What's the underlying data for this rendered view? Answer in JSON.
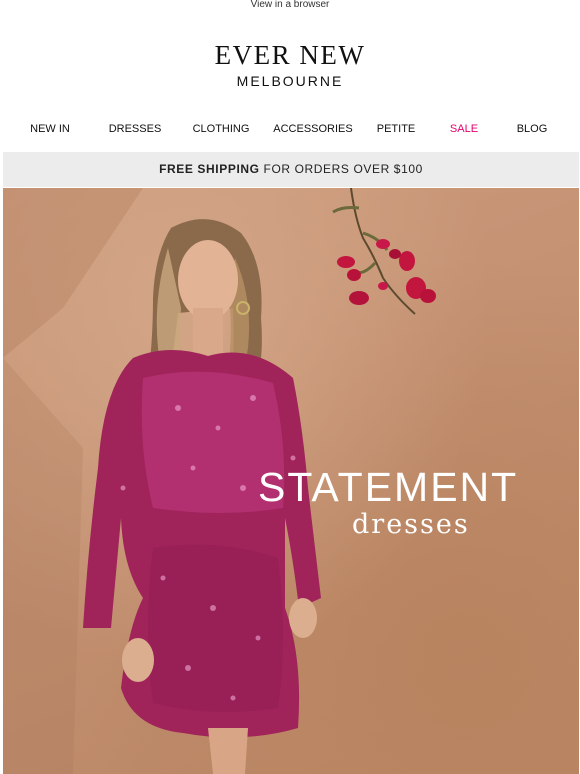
{
  "header": {
    "view_in_browser": "View in a browser"
  },
  "logo": {
    "brand": "EVER NEW",
    "city": "MELBOURNE"
  },
  "nav": {
    "items": [
      {
        "label": "NEW IN"
      },
      {
        "label": "DRESSES"
      },
      {
        "label": "CLOTHING"
      },
      {
        "label": "ACCESSORIES"
      },
      {
        "label": "PETITE"
      },
      {
        "label": "SALE"
      },
      {
        "label": "BLOG"
      }
    ],
    "sale_color": "#e6006e"
  },
  "banner": {
    "bold": "FREE SHIPPING",
    "rest": "FOR ORDERS OVER $100"
  },
  "hero": {
    "headline_big": "STATEMENT",
    "headline_small": "dresses",
    "background_color": "#c7967a",
    "dress_color": "#a0235a"
  }
}
